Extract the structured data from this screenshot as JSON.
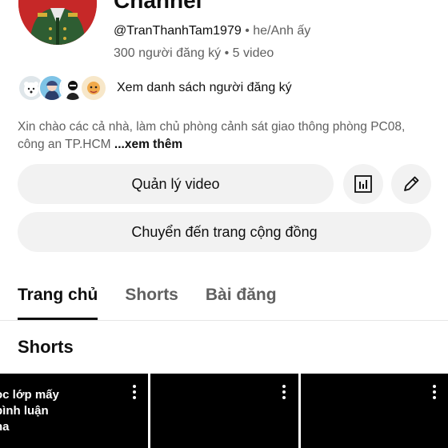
{
  "channel": {
    "title": "Channel",
    "handle": "@TranThanhTam1979",
    "separator": "•",
    "pronouns": "he/Anh ấy",
    "stats": "300 người đăng ký • 5 video",
    "subscribers_label": "Xem danh sách người đăng ký",
    "description": "Xin chào các cả nhà, làm chủ phòng cảnh sát giao thông phòng PC08, công an TP.HCM",
    "description_more": "...xem thêm"
  },
  "actions": {
    "manage_videos": "Quản lý video",
    "go_community": "Chuyển đến trang cộng đồng",
    "analytics_icon": "analytics-icon",
    "edit_icon": "pencil-icon"
  },
  "tabs": [
    {
      "label": "Trang chủ",
      "active": true
    },
    {
      "label": "Shorts",
      "active": false
    },
    {
      "label": "Bài đăng",
      "active": false
    }
  ],
  "sections": {
    "shorts_title": "Shorts"
  },
  "shorts": [
    {
      "overlay_text": "ọc lớp mấy\n bình luận\nna"
    },
    {
      "overlay_text": ""
    },
    {
      "overlay_text": ""
    }
  ],
  "colors": {
    "avatar_bg": "#c62828",
    "button_bg": "#f2f2f2",
    "text_secondary": "#606060"
  }
}
